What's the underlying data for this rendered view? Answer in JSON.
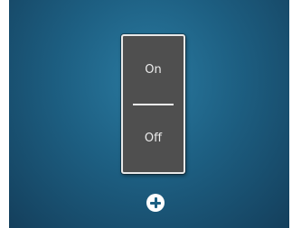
{
  "switch": {
    "on_label": "On",
    "off_label": "Off"
  },
  "add_button": {
    "icon": "plus-circle-icon"
  },
  "colors": {
    "background": "#1d5f82",
    "switch_body": "#4f4f4f",
    "switch_border": "#e9e9e9",
    "text": "#ececec"
  }
}
